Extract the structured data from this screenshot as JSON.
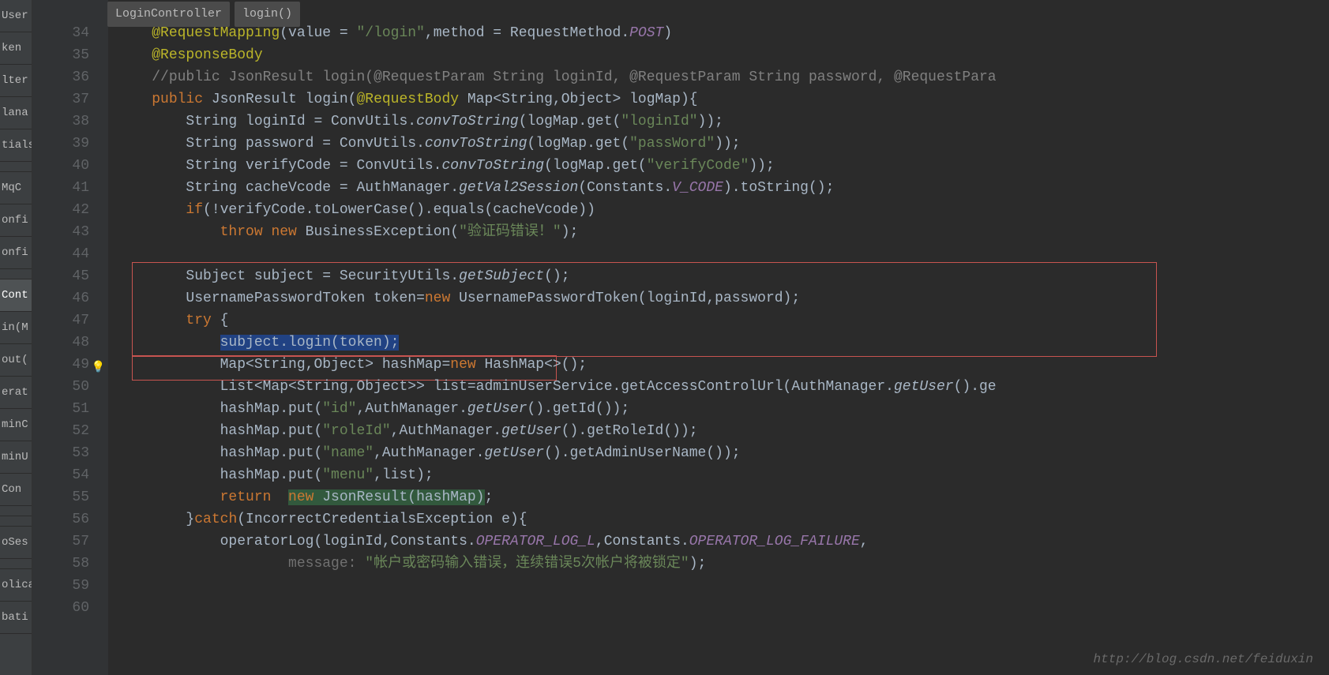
{
  "breadcrumb": {
    "class": "LoginController",
    "method": "login()"
  },
  "tabs": [
    "User",
    "ken",
    "lter",
    "lana",
    "tials",
    "",
    "MqC",
    "onfi",
    "onfi",
    "",
    "Cont",
    "in(M",
    "out(",
    "erat",
    "minC",
    "minU",
    "Con",
    "",
    "",
    "oSes",
    "",
    "olica",
    "bati"
  ],
  "activeTabIndex": 10,
  "startLine": 34,
  "endLine": 60,
  "tokens": {
    "ann_RequestMapping": "@RequestMapping",
    "ann_ResponseBody": "@ResponseBody",
    "ann_RequestBody": "@RequestBody",
    "kw_public": "public",
    "kw_throw": "throw",
    "kw_new": "new",
    "kw_try": "try",
    "kw_return": "return",
    "kw_catch": "catch",
    "kw_if": "if",
    "str_login": "\"/login\"",
    "str_loginId": "\"loginId\"",
    "str_passWord": "\"passWord\"",
    "str_verifyCode": "\"verifyCode\"",
    "str_vcodeerr": "\"验证码错误！\"",
    "str_id": "\"id\"",
    "str_roleId": "\"roleId\"",
    "str_name": "\"name\"",
    "str_menu": "\"menu\"",
    "str_lockmsg": "\"帐户或密码输入错误，连续错误5次帐户将被锁定\"",
    "com_login": "//public JsonResult login(@RequestParam String loginId, @RequestParam String password, @RequestPara",
    "ital_POST": "POST",
    "ital_convToString": "convToString",
    "ital_getVal2Session": "getVal2Session",
    "ital_V_CODE": "V_CODE",
    "ital_getSubject": "getSubject",
    "ital_getUser": "getUser",
    "ital_OP_L": "OPERATOR_LOG_L",
    "ital_OP_F": "OPERATOR_LOG_FAILURE",
    "sel_text": "subject.login(token);",
    "hint_message": "message:",
    "plain": {
      "value_eq": "(value = ",
      "method_eq": ",method = RequestMethod.",
      "close_paren": ")",
      "jsonresult": " JsonResult login(",
      "mapdecl": " Map<String,Object> logMap){",
      "loginId_line": "String loginId = ConvUtils.",
      "logmap_get1": "(logMap.get(",
      "close2": "));",
      "password_line": "String password = ConvUtils.",
      "verify_line": "String verifyCode = ConvUtils.",
      "cache_line": "String cacheVcode = AuthManager.",
      "constants": "(Constants.",
      "tostr": ").toString();",
      "ifcond": "(!verifyCode.toLowerCase().equals(cacheVcode))",
      "bexc": " BusinessException(",
      "close3": ");",
      "subj_line": "Subject subject = SecurityUtils.",
      "paren_sc": "();",
      "token_decl": "UsernamePasswordToken token=",
      "token_new": " UsernamePasswordToken(loginId,password);",
      "try_brace": " {",
      "hashmap_decl": "Map<String,Object> hashMap=",
      "hashmap_new": " HashMap<>();",
      "list_decl": "List<Map<String,Object>> list=adminUserService.getAccessControlUrl(AuthManager.",
      "list_tail": "().ge",
      "put_id": "hashMap.put(",
      "auth_getuser": ",AuthManager.",
      "getid": "().getId());",
      "getroleid": "().getRoleId());",
      "getadmin": "().getAdminUserName());",
      "putlist": ",list);",
      "json_new": " JsonResult(hashMap)",
      "close_sc": ";",
      "catch_open": "}",
      "catch_sig": "(IncorrectCredentialsException e){",
      "oplog": "operatorLog(loginId,Constants.",
      "comma_const": ",Constants.",
      "comma": ","
    }
  },
  "watermark": "http://blog.csdn.net/feiduxin"
}
